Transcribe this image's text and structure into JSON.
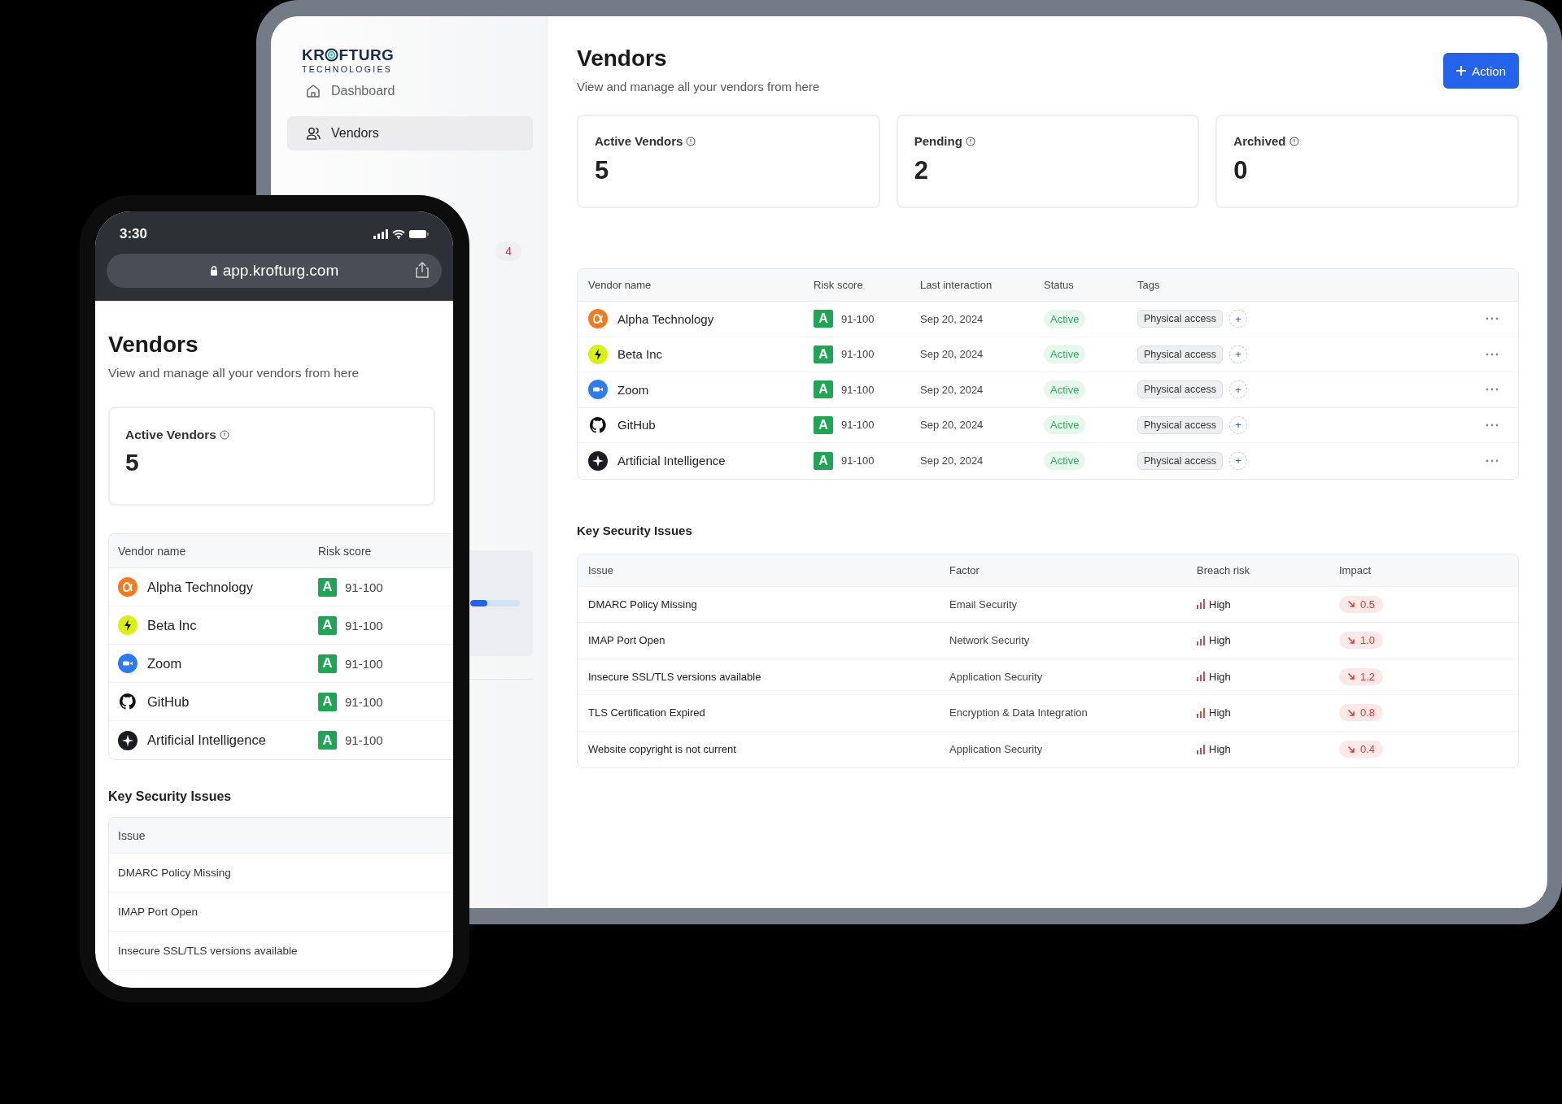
{
  "tablet": {
    "sidebar": {
      "logo": {
        "text_left": "KR",
        "text_right": "FTURG",
        "subtitle": "TECHNOLOGIES"
      },
      "nav": [
        {
          "kind": "home",
          "label": "Dashboard",
          "selected": false
        },
        {
          "kind": "users",
          "label": "Vendors",
          "selected": true
        }
      ],
      "badge": "4",
      "progress": {
        "level": 0.35
      }
    },
    "header": {
      "title": "Vendors",
      "subtitle": "View and manage all your vendors from here",
      "action": "Action"
    },
    "stats": [
      {
        "label": "Active Vendors",
        "value": "5"
      },
      {
        "label": "Pending",
        "value": "2"
      },
      {
        "label": "Archived",
        "value": "0"
      }
    ],
    "vendors": {
      "columns": [
        "Vendor name",
        "Risk score",
        "Last interaction",
        "Status",
        "Tags"
      ],
      "rows": [
        {
          "kind": "alpha",
          "name": "Alpha Technology",
          "grade": "A",
          "score": "91-100",
          "last_interaction": "Sep 20, 2024",
          "status": "Active",
          "tag": "Physical access",
          "add": "+"
        },
        {
          "kind": "bolt",
          "name": "Beta Inc",
          "grade": "A",
          "score": "91-100",
          "last_interaction": "Sep 20, 2024",
          "status": "Active",
          "tag": "Physical access",
          "add": "+"
        },
        {
          "kind": "camera",
          "name": "Zoom",
          "grade": "A",
          "score": "91-100",
          "last_interaction": "Sep 20, 2024",
          "status": "Active",
          "tag": "Physical access",
          "add": "+"
        },
        {
          "kind": "cat",
          "name": "GitHub",
          "grade": "A",
          "score": "91-100",
          "last_interaction": "Sep 20, 2024",
          "status": "Active",
          "tag": "Physical access",
          "add": "+"
        },
        {
          "kind": "sparkle",
          "name": "Artificial Intelligence",
          "grade": "A",
          "score": "91-100",
          "last_interaction": "Sep 20, 2024",
          "status": "Active",
          "tag": "Physical access",
          "add": "+"
        }
      ]
    },
    "security": {
      "title": "Key Security Issues",
      "columns": [
        "Issue",
        "Factor",
        "Breach risk",
        "Impact"
      ],
      "rows": [
        {
          "issue": "DMARC Policy Missing",
          "factor": "Email Security",
          "breach_risk": "High",
          "impact": "0.5"
        },
        {
          "issue": "IMAP Port Open",
          "factor": "Network Security",
          "breach_risk": "High",
          "impact": "1.0"
        },
        {
          "issue": "Insecure SSL/TLS versions available",
          "factor": "Application Security",
          "breach_risk": "High",
          "impact": "1.2"
        },
        {
          "issue": "TLS Certification Expired",
          "factor": "Encryption & Data Integration",
          "breach_risk": "High",
          "impact": "0.8"
        },
        {
          "issue": "Website copyright is not current",
          "factor": "Application Security",
          "breach_risk": "High",
          "impact": "0.4"
        }
      ]
    }
  },
  "phone": {
    "status_bar": {
      "time": "3:30"
    },
    "address_bar": {
      "url": "app.krofturg.com"
    },
    "header": {
      "title": "Vendors",
      "subtitle": "View and manage all your vendors from here"
    },
    "stats": [
      {
        "label": "Active Vendors",
        "value": "5"
      }
    ],
    "vendors": {
      "columns": [
        "Vendor name",
        "Risk score"
      ],
      "rows": [
        {
          "kind": "alpha",
          "name": "Alpha Technology",
          "grade": "A",
          "score": "91-100"
        },
        {
          "kind": "bolt",
          "name": "Beta Inc",
          "grade": "A",
          "score": "91-100"
        },
        {
          "kind": "camera",
          "name": "Zoom",
          "grade": "A",
          "score": "91-100"
        },
        {
          "kind": "cat",
          "name": "GitHub",
          "grade": "A",
          "score": "91-100"
        },
        {
          "kind": "sparkle",
          "name": "Artificial Intelligence",
          "grade": "A",
          "score": "91-100"
        }
      ]
    },
    "security": {
      "title": "Key Security Issues",
      "columns": [
        "Issue"
      ],
      "rows": [
        {
          "issue": "DMARC Policy Missing"
        },
        {
          "issue": "IMAP Port Open"
        },
        {
          "issue": "Insecure SSL/TLS versions available"
        }
      ]
    }
  }
}
